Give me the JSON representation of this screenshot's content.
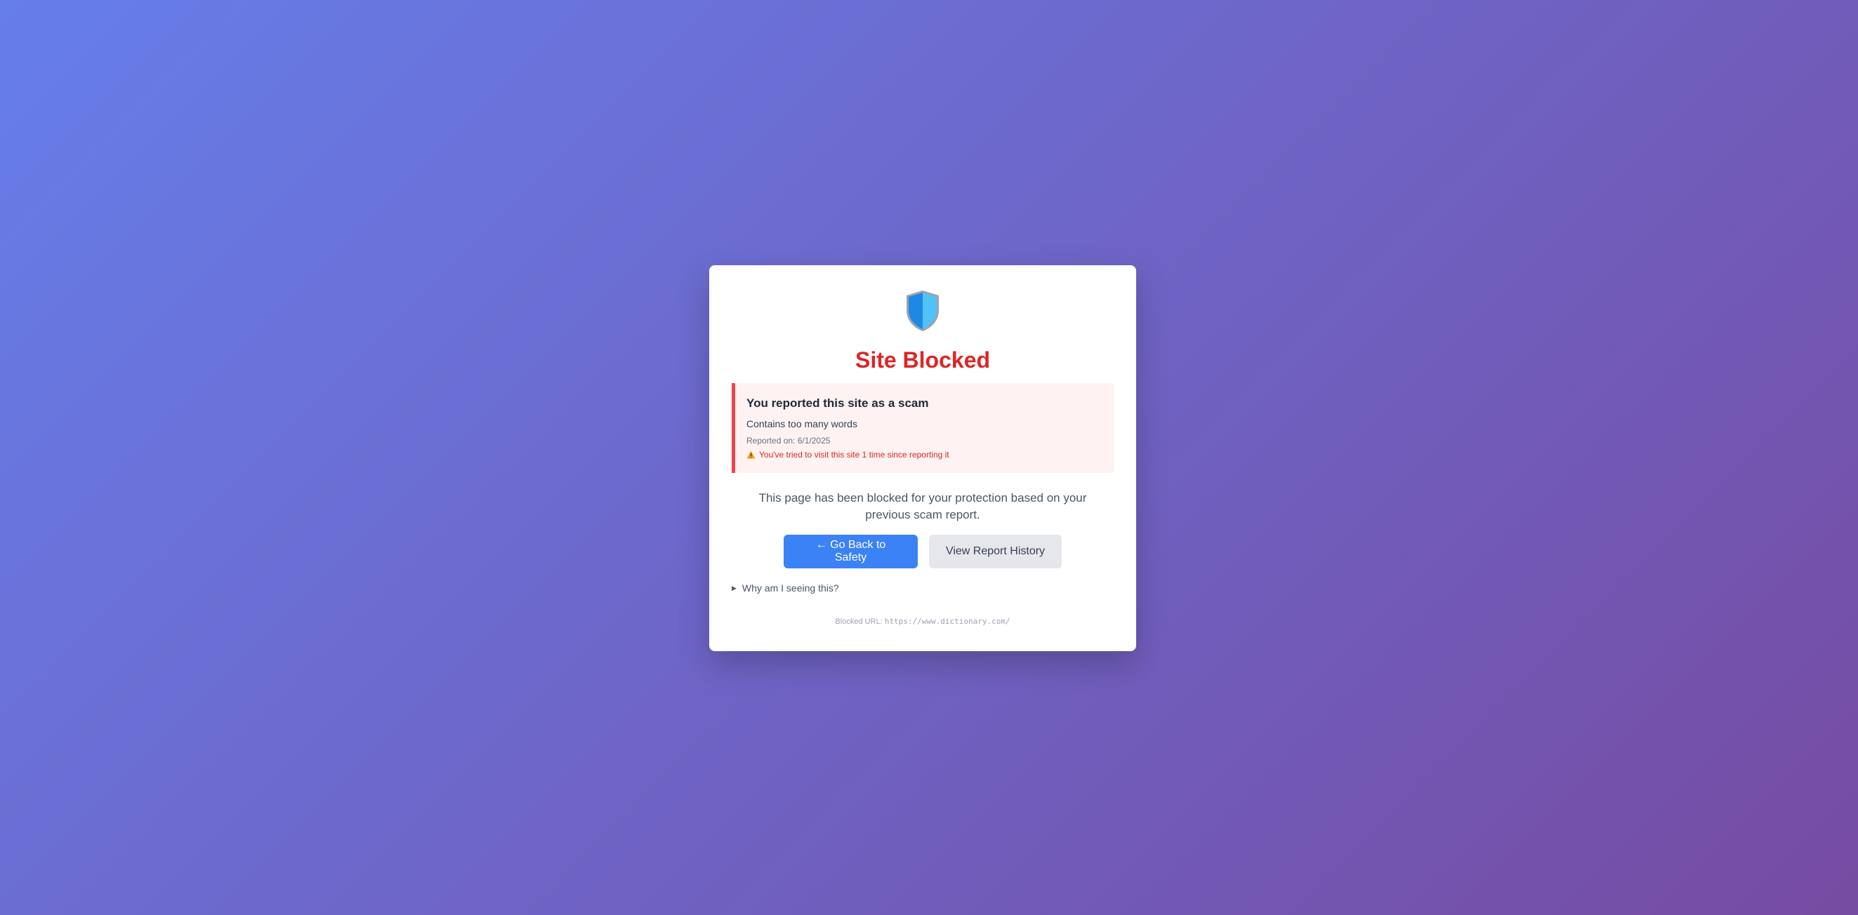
{
  "page": {
    "title": "Site Blocked",
    "shield_icon": "shield-icon",
    "accent_color": "#dc2626"
  },
  "alert": {
    "heading": "You reported this site as a scam",
    "reason": "Contains too many words",
    "reported_on": "Reported on: 6/1/2025",
    "warning_icon": "warning-icon",
    "warning": "You've tried to visit this site 1 time since reporting it"
  },
  "message": "This page has been blocked for your protection based on your previous scam report.",
  "buttons": {
    "back": "← Go Back to Safety",
    "history": "View Report History"
  },
  "details": {
    "summary": "Why am I seeing this?"
  },
  "footer": {
    "label": "Blocked URL:",
    "url": "https://www.dictionary.com/"
  }
}
